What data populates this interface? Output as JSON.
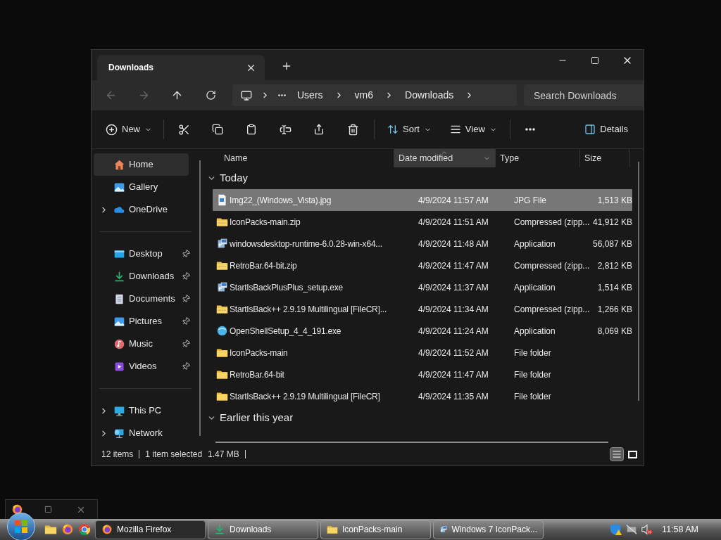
{
  "window": {
    "tab_title": "Downloads"
  },
  "address": {
    "segments": [
      "Users",
      "vm6",
      "Downloads"
    ]
  },
  "search": {
    "placeholder": "Search Downloads"
  },
  "toolbar": {
    "new": "New",
    "sort": "Sort",
    "view": "View",
    "details": "Details"
  },
  "sidebar": {
    "groups": [
      [
        {
          "label": "Home",
          "kind": "home",
          "selected": true,
          "expandable": false,
          "pinned": false
        },
        {
          "label": "Gallery",
          "kind": "gallery",
          "selected": false,
          "expandable": false,
          "pinned": false
        },
        {
          "label": "OneDrive",
          "kind": "cloud",
          "selected": false,
          "expandable": true,
          "pinned": false
        }
      ],
      [
        {
          "label": "Desktop",
          "kind": "desktop",
          "selected": false,
          "expandable": false,
          "pinned": true
        },
        {
          "label": "Downloads",
          "kind": "download",
          "selected": false,
          "expandable": false,
          "pinned": true
        },
        {
          "label": "Documents",
          "kind": "document",
          "selected": false,
          "expandable": false,
          "pinned": true
        },
        {
          "label": "Pictures",
          "kind": "pictures",
          "selected": false,
          "expandable": false,
          "pinned": true
        },
        {
          "label": "Music",
          "kind": "music",
          "selected": false,
          "expandable": false,
          "pinned": true
        },
        {
          "label": "Videos",
          "kind": "videos",
          "selected": false,
          "expandable": false,
          "pinned": true
        }
      ],
      [
        {
          "label": "This PC",
          "kind": "pc",
          "selected": false,
          "expandable": true,
          "pinned": false
        },
        {
          "label": "Network",
          "kind": "network",
          "selected": false,
          "expandable": true,
          "pinned": false
        }
      ]
    ]
  },
  "columns": [
    {
      "label": "Name",
      "sorted": false
    },
    {
      "label": "Date modified",
      "sorted": true
    },
    {
      "label": "Type",
      "sorted": false
    },
    {
      "label": "Size",
      "sorted": false
    }
  ],
  "groups": [
    {
      "title": "Today",
      "expanded": true,
      "rows": [
        {
          "name": "Img22_(Windows_Vista).jpg",
          "date": "4/9/2024 11:57 AM",
          "type": "JPG File",
          "size": "1,513 KB",
          "kind": "image",
          "selected": true
        },
        {
          "name": "IconPacks-main.zip",
          "date": "4/9/2024 11:51 AM",
          "type": "Compressed (zipp...",
          "size": "41,912 KB",
          "kind": "zip",
          "selected": false
        },
        {
          "name": "windowsdesktop-runtime-6.0.28-win-x64...",
          "date": "4/9/2024 11:48 AM",
          "type": "Application",
          "size": "56,087 KB",
          "kind": "app",
          "selected": false
        },
        {
          "name": "RetroBar.64-bit.zip",
          "date": "4/9/2024 11:47 AM",
          "type": "Compressed (zipp...",
          "size": "2,812 KB",
          "kind": "zip",
          "selected": false
        },
        {
          "name": "StartIsBackPlusPlus_setup.exe",
          "date": "4/9/2024 11:37 AM",
          "type": "Application",
          "size": "1,514 KB",
          "kind": "app",
          "selected": false
        },
        {
          "name": "StartIsBack++ 2.9.19 Multilingual [FileCR]...",
          "date": "4/9/2024 11:34 AM",
          "type": "Compressed (zipp...",
          "size": "1,266 KB",
          "kind": "zip",
          "selected": false
        },
        {
          "name": "OpenShellSetup_4_4_191.exe",
          "date": "4/9/2024 11:24 AM",
          "type": "Application",
          "size": "8,069 KB",
          "kind": "shell",
          "selected": false
        },
        {
          "name": "IconPacks-main",
          "date": "4/9/2024 11:52 AM",
          "type": "File folder",
          "kind": "folder",
          "selected": false
        },
        {
          "name": "RetroBar.64-bit",
          "date": "4/9/2024 11:47 AM",
          "type": "File folder",
          "kind": "folder",
          "selected": false
        },
        {
          "name": "StartIsBack++ 2.9.19 Multilingual [FileCR]",
          "date": "4/9/2024 11:35 AM",
          "type": "File folder",
          "kind": "folder",
          "selected": false
        }
      ]
    },
    {
      "title": "Earlier this year",
      "expanded": true
    }
  ],
  "status_bar": {
    "items": "12 items",
    "selection": "1 item selected",
    "size": "1.47 MB"
  },
  "view_toggles": [
    {
      "kind": "details",
      "selected": true
    },
    {
      "kind": "tiles",
      "selected": false
    }
  ],
  "taskbar": {
    "tasks": [
      {
        "label": "Mozilla Firefox",
        "kind": "firefox",
        "selected": true
      },
      {
        "label": "Downloads",
        "kind": "download",
        "selected": false
      },
      {
        "label": "IconPacks-main",
        "kind": "folder",
        "selected": false
      },
      {
        "label": "Windows 7 IconPack...",
        "kind": "app",
        "selected": false
      }
    ],
    "clock": "11:58 AM"
  }
}
